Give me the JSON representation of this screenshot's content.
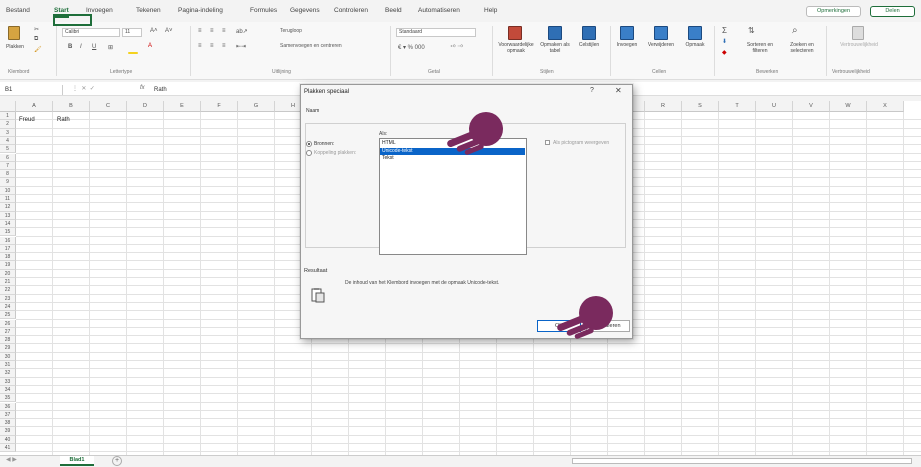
{
  "tabs": [
    "Bestand",
    "Start",
    "Invoegen",
    "Tekenen",
    "Pagina-indeling",
    "Formules",
    "Gegevens",
    "Controleren",
    "Beeld",
    "Automatiseren",
    "Help"
  ],
  "active_tab": "Start",
  "header_buttons": {
    "comments": "Opmerkingen",
    "share": "Delen"
  },
  "ribbon": {
    "paste_label": "Plakken",
    "font_name": "Calibri",
    "font_size": "11",
    "wrap_text": "Terugloop",
    "merge_center": "Samenvoegen en centreren",
    "number_format": "Standaard",
    "cond_format": "Voorwaardelijke opmaak",
    "format_as_table": "Opmaken als tabel",
    "cell_styles": "Celstijlen",
    "insert": "Invoegen",
    "delete": "Verwijderen",
    "format": "Opmaak",
    "sort_filter": "Sorteren en filteren",
    "find_select": "Zoeken en selecteren",
    "sensitivity": "Vertrouwelijkheid",
    "groups": [
      "Klembord",
      "Lettertype",
      "Uitlijning",
      "Getal",
      "Stijlen",
      "Cellen",
      "Bewerken",
      "Vertrouwelijkheid"
    ]
  },
  "formula_bar": {
    "name_box": "B1",
    "content": "Rath"
  },
  "columns": [
    "A",
    "B",
    "C",
    "D",
    "E",
    "F",
    "G",
    "H",
    "I",
    "J",
    "K",
    "L",
    "M",
    "N",
    "O",
    "P",
    "Q",
    "R",
    "S",
    "T",
    "U",
    "V",
    "W",
    "X"
  ],
  "rows": [
    "1",
    "2",
    "3",
    "4",
    "5",
    "6",
    "7",
    "8",
    "9",
    "10",
    "11",
    "12",
    "13",
    "14",
    "15",
    "16",
    "17",
    "18",
    "19",
    "20",
    "21",
    "22",
    "23",
    "24",
    "25",
    "26",
    "27",
    "28",
    "29",
    "30",
    "31",
    "32",
    "33",
    "34",
    "35",
    "36",
    "37",
    "38",
    "39",
    "40",
    "41"
  ],
  "cells": {
    "A1": "Freud",
    "B1": "Rath"
  },
  "sheet_tab": "Blad1",
  "dialog": {
    "title": "Plakken speciaal",
    "help": "?",
    "close": "✕",
    "name_label": "Naam",
    "source_radio_label": "Bronnen:",
    "link_radio_label": "Koppeling plakken:",
    "as_label": "Als:",
    "list_items": [
      "HTML",
      "Unicode-tekst",
      "Tekst"
    ],
    "selected_index": 1,
    "show_as_icon_label": "Als pictogram weergeven",
    "result_label": "Resultaat",
    "result_text": "De inhoud van het Klembord invoegen met de opmaak Unicode-tekst.",
    "ok_label": "OK",
    "cancel_label": "Annuleren"
  },
  "colors": {
    "accent": "#1e6e3a",
    "selection": "#0a64c8",
    "hand": "#7a2a5e"
  }
}
